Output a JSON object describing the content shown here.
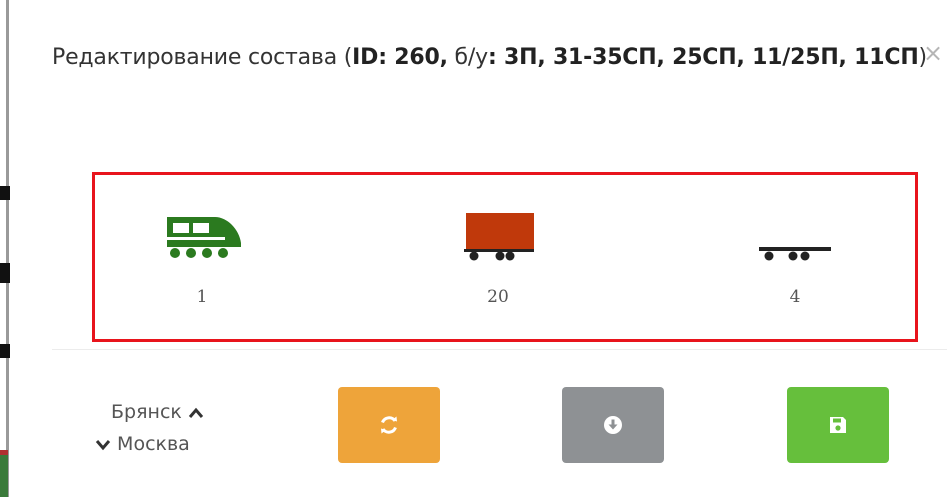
{
  "modal": {
    "title_prefix": "Редактирование состава (",
    "id_label": "ID: 260,",
    "used_label": " б/у",
    "used_values": ": 3П, 31-35СП, 25СП, 11/25П, 11СП",
    "title_suffix": ")",
    "close_label": "×"
  },
  "rolling_stock": [
    {
      "type": "locomotive",
      "icon": "locomotive-icon",
      "count": "1",
      "color": "#2b7a1f"
    },
    {
      "type": "wagon",
      "icon": "boxcar-icon",
      "count": "20",
      "color": "#c0390b"
    },
    {
      "type": "platform",
      "icon": "flatcar-icon",
      "count": "4",
      "color": "#222222"
    }
  ],
  "route": {
    "from": "Брянск",
    "to": "Москва"
  },
  "actions": {
    "refresh_icon": "refresh-icon",
    "download_icon": "download-icon",
    "save_icon": "floppy-disk-icon",
    "refresh_color": "#eea43a",
    "download_color": "#8e9194",
    "save_color": "#66bf3c"
  },
  "highlight_color": "#e8141c"
}
